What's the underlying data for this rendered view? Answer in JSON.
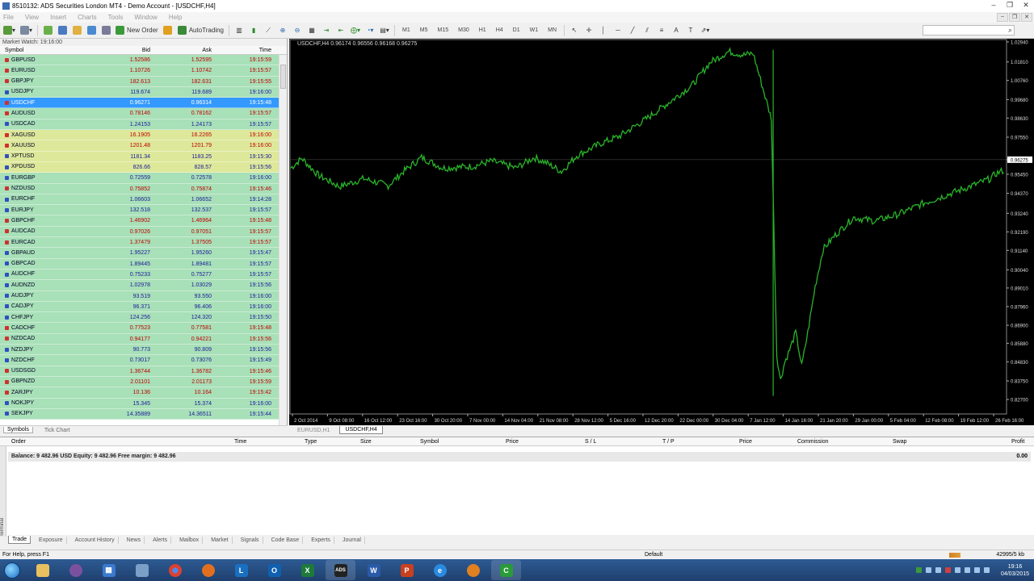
{
  "window": {
    "title": "8510132: ADS Securities London MT4 - Demo Account - [USDCHF,H4]"
  },
  "menu": [
    "File",
    "View",
    "Insert",
    "Charts",
    "Tools",
    "Window",
    "Help"
  ],
  "toolbar": {
    "new_order": "New Order",
    "autotrading": "AutoTrading",
    "timeframes": [
      "M1",
      "M5",
      "M15",
      "M30",
      "H1",
      "H4",
      "D1",
      "W1",
      "MN"
    ]
  },
  "market_watch": {
    "title": "Market Watch: 19:16:00",
    "headers": {
      "symbol": "Symbol",
      "bid": "Bid",
      "ask": "Ask",
      "time": "Time"
    },
    "rows": [
      {
        "symbol": "GBPUSD",
        "bid": "1.52586",
        "ask": "1.52595",
        "time": "19:15:59",
        "dir": "down",
        "bg": "#a8e0b8"
      },
      {
        "symbol": "EURUSD",
        "bid": "1.10726",
        "ask": "1.10742",
        "time": "19:15:57",
        "dir": "down",
        "bg": "#a8e0b8"
      },
      {
        "symbol": "GBPJPY",
        "bid": "182.613",
        "ask": "182.631",
        "time": "19:15:55",
        "dir": "down",
        "bg": "#a8e0b8"
      },
      {
        "symbol": "USDJPY",
        "bid": "119.674",
        "ask": "119.689",
        "time": "19:16:00",
        "dir": "up",
        "bg": "#a8e0b8"
      },
      {
        "symbol": "USDCHF",
        "bid": "0.96271",
        "ask": "0.96314",
        "time": "19:15:48",
        "dir": "down",
        "bg": "#3399ff",
        "selected": true
      },
      {
        "symbol": "AUDUSD",
        "bid": "0.78146",
        "ask": "0.78162",
        "time": "19:15:57",
        "dir": "down",
        "bg": "#a8e0b8"
      },
      {
        "symbol": "USDCAD",
        "bid": "1.24153",
        "ask": "1.24173",
        "time": "19:15:57",
        "dir": "up",
        "bg": "#a8e0b8"
      },
      {
        "symbol": "XAGUSD",
        "bid": "16.1905",
        "ask": "16.2265",
        "time": "19:16:00",
        "dir": "down",
        "bg": "#dde89a"
      },
      {
        "symbol": "XAUUSD",
        "bid": "1201.48",
        "ask": "1201.79",
        "time": "19:16:00",
        "dir": "down",
        "bg": "#dde89a"
      },
      {
        "symbol": "XPTUSD",
        "bid": "1181.34",
        "ask": "1183.25",
        "time": "19:15:30",
        "dir": "up",
        "bg": "#dde89a"
      },
      {
        "symbol": "XPDUSD",
        "bid": "826.66",
        "ask": "828.57",
        "time": "19:15:56",
        "dir": "up",
        "bg": "#dde89a"
      },
      {
        "symbol": "EURGBP",
        "bid": "0.72559",
        "ask": "0.72578",
        "time": "19:16:00",
        "dir": "up",
        "bg": "#a8e0b8"
      },
      {
        "symbol": "NZDUSD",
        "bid": "0.75852",
        "ask": "0.75874",
        "time": "19:15:46",
        "dir": "down",
        "bg": "#a8e0b8"
      },
      {
        "symbol": "EURCHF",
        "bid": "1.06603",
        "ask": "1.06652",
        "time": "19:14:28",
        "dir": "up",
        "bg": "#a8e0b8"
      },
      {
        "symbol": "EURJPY",
        "bid": "132.518",
        "ask": "132.537",
        "time": "19:15:57",
        "dir": "up",
        "bg": "#a8e0b8"
      },
      {
        "symbol": "GBPCHF",
        "bid": "1.46902",
        "ask": "1.46964",
        "time": "19:15:48",
        "dir": "down",
        "bg": "#a8e0b8"
      },
      {
        "symbol": "AUDCAD",
        "bid": "0.97026",
        "ask": "0.97051",
        "time": "19:15:57",
        "dir": "down",
        "bg": "#a8e0b8"
      },
      {
        "symbol": "EURCAD",
        "bid": "1.37479",
        "ask": "1.37505",
        "time": "19:15:57",
        "dir": "down",
        "bg": "#a8e0b8"
      },
      {
        "symbol": "GBPAUD",
        "bid": "1.95227",
        "ask": "1.95260",
        "time": "19:15:47",
        "dir": "up",
        "bg": "#a8e0b8"
      },
      {
        "symbol": "GBPCAD",
        "bid": "1.89445",
        "ask": "1.89481",
        "time": "19:15:57",
        "dir": "up",
        "bg": "#a8e0b8"
      },
      {
        "symbol": "AUDCHF",
        "bid": "0.75233",
        "ask": "0.75277",
        "time": "19:15:57",
        "dir": "up",
        "bg": "#a8e0b8"
      },
      {
        "symbol": "AUDNZD",
        "bid": "1.02978",
        "ask": "1.03029",
        "time": "19:15:56",
        "dir": "up",
        "bg": "#a8e0b8"
      },
      {
        "symbol": "AUDJPY",
        "bid": "93.519",
        "ask": "93.550",
        "time": "19:16:00",
        "dir": "up",
        "bg": "#a8e0b8"
      },
      {
        "symbol": "CADJPY",
        "bid": "96.371",
        "ask": "96.406",
        "time": "19:16:00",
        "dir": "up",
        "bg": "#a8e0b8"
      },
      {
        "symbol": "CHFJPY",
        "bid": "124.256",
        "ask": "124.320",
        "time": "19:15:50",
        "dir": "up",
        "bg": "#a8e0b8"
      },
      {
        "symbol": "CADCHF",
        "bid": "0.77523",
        "ask": "0.77581",
        "time": "19:15:48",
        "dir": "down",
        "bg": "#a8e0b8"
      },
      {
        "symbol": "NZDCAD",
        "bid": "0.94177",
        "ask": "0.94221",
        "time": "19:15:56",
        "dir": "down",
        "bg": "#a8e0b8"
      },
      {
        "symbol": "NZDJPY",
        "bid": "90.773",
        "ask": "90.809",
        "time": "19:15:56",
        "dir": "up",
        "bg": "#a8e0b8"
      },
      {
        "symbol": "NZDCHF",
        "bid": "0.73017",
        "ask": "0.73076",
        "time": "19:15:49",
        "dir": "up",
        "bg": "#a8e0b8"
      },
      {
        "symbol": "USDSGD",
        "bid": "1.36744",
        "ask": "1.36782",
        "time": "19:15:46",
        "dir": "down",
        "bg": "#a8e0b8"
      },
      {
        "symbol": "GBPNZD",
        "bid": "2.01101",
        "ask": "2.01173",
        "time": "19:15:59",
        "dir": "down",
        "bg": "#a8e0b8"
      },
      {
        "symbol": "ZARJPY",
        "bid": "10.136",
        "ask": "10.164",
        "time": "19:15:42",
        "dir": "down",
        "bg": "#a8e0b8"
      },
      {
        "symbol": "NOKJPY",
        "bid": "15.345",
        "ask": "15.374",
        "time": "19:16:00",
        "dir": "up",
        "bg": "#a8e0b8"
      },
      {
        "symbol": "SEKJPY",
        "bid": "14.35889",
        "ask": "14.36511",
        "time": "19:15:44",
        "dir": "up",
        "bg": "#a8e0b8"
      }
    ],
    "tabs": [
      "Symbols",
      "Tick Chart"
    ]
  },
  "chart": {
    "header": "USDCHF,H4  0.96174 0.96556 0.96168 0.96275",
    "price_labels": [
      "1.02940",
      "1.01810",
      "1.00760",
      "0.99680",
      "0.98630",
      "0.97550",
      "0.96275",
      "0.95450",
      "0.94370",
      "0.93240",
      "0.92190",
      "0.91140",
      "0.90040",
      "0.89010",
      "0.87960",
      "0.86900",
      "0.85880",
      "0.84830",
      "0.83750",
      "0.82700"
    ],
    "current_price": "0.96275",
    "time_labels": [
      "2 Oct 2014",
      "9 Oct 08:00",
      "16 Oct 12:00",
      "23 Oct 16:00",
      "30 Oct 20:00",
      "7 Nov 00:00",
      "14 Nov 04:00",
      "21 Nov 08:00",
      "28 Nov 12:00",
      "5 Dec 16:00",
      "12 Dec 20:00",
      "22 Dec 00:00",
      "30 Dec 04:00",
      "7 Jan 12:00",
      "14 Jan 16:00",
      "21 Jan 20:00",
      "29 Jan 00:00",
      "5 Feb 04:00",
      "12 Feb 08:00",
      "19 Feb 12:00",
      "26 Feb 16:00"
    ],
    "line_color": "#29b429",
    "background": "#000000",
    "tabs": [
      "EURUSD,H1",
      "USDCHF,H4"
    ]
  },
  "terminal": {
    "side_label": "Terminal",
    "columns": [
      "Order",
      "Time",
      "Type",
      "Size",
      "Symbol",
      "Price",
      "S / L",
      "T / P",
      "Price",
      "Commission",
      "Swap",
      "Profit"
    ],
    "balance_text": "Balance: 9 482.96 USD  Equity: 9 482.96  Free margin: 9 482.96",
    "profit": "0.00",
    "tabs": [
      "Trade",
      "Exposure",
      "Account History",
      "News",
      "Alerts",
      "Mailbox",
      "Market",
      "Signals",
      "Code Base",
      "Experts",
      "Journal"
    ]
  },
  "status": {
    "help": "For Help, press F1",
    "profile": "Default",
    "traffic": "42995/5 kb"
  },
  "taskbar": {
    "time": "19:16",
    "date": "04/03/2015"
  }
}
